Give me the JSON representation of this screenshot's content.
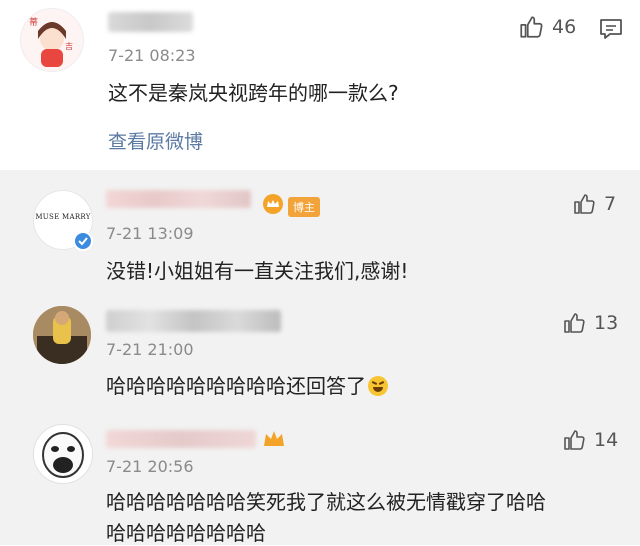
{
  "main_comment": {
    "time": "7-21 08:23",
    "text": "这不是秦岚央视跨年的哪一款么?",
    "likes": "46",
    "view_original": "查看原微博"
  },
  "replies": [
    {
      "time": "7-21 13:09",
      "text": "没错!小姐姐有一直关注我们,感谢!",
      "likes": "7",
      "badge": "博主",
      "avatar_brand": "MUSE MARRY"
    },
    {
      "time": "7-21 21:00",
      "text": "哈哈哈哈哈哈哈哈哈还回答了",
      "likes": "13"
    },
    {
      "time": "7-21 20:56",
      "text_line1": "哈哈哈哈哈哈哈笑死我了就这么被无情戳穿了哈哈",
      "text_line2": "哈哈哈哈哈哈哈哈",
      "likes": "14"
    }
  ],
  "colors": {
    "link": "#5b7aa3",
    "badge": "#f2a33a",
    "verified": "#3b8be0",
    "reply_bg": "#f2f2f2"
  }
}
